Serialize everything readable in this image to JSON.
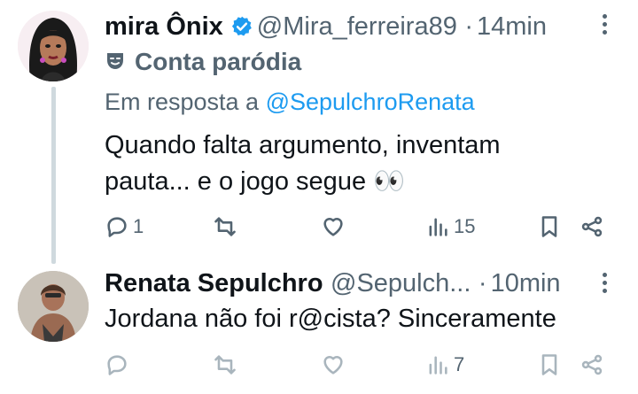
{
  "tweet1": {
    "display_name": "mira Ônix",
    "handle": "@Mira_ferreira89",
    "separator": "·",
    "time": "14min",
    "parody_label": "Conta paródia",
    "reply_prefix": "Em resposta a",
    "reply_to": "@SepulchroRenata",
    "text_line1": "Quando falta argumento, inventam",
    "text_line2": "pauta... e o jogo segue 👀",
    "replies": "1",
    "views": "15"
  },
  "tweet2": {
    "display_name": "Renata Sepulchro",
    "handle": "@Sepulch...",
    "separator": "·",
    "time": "10min",
    "text": "Jordana não foi r@cista? Sinceramente",
    "views": "7"
  },
  "colors": {
    "accent": "#1d9bf0",
    "muted": "#536471",
    "text": "#0f1419"
  },
  "icons": [
    "verified-badge-icon",
    "theater-mask-icon",
    "reply-icon",
    "retweet-icon",
    "like-icon",
    "views-icon",
    "bookmark-icon",
    "share-icon",
    "more-icon"
  ]
}
